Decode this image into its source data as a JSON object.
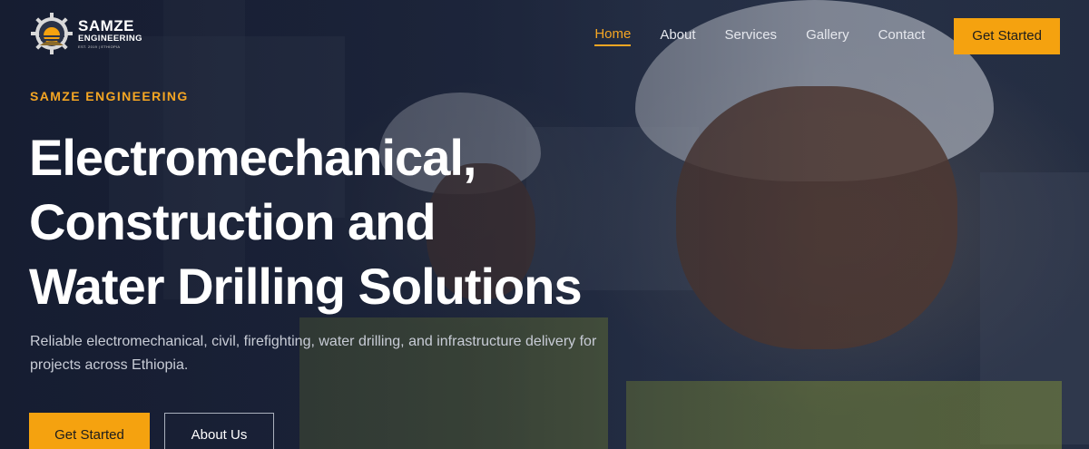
{
  "brand": {
    "name": "SAMZE",
    "sub": "ENGINEERING",
    "tagline": "EST. 2019 | ETHIOPIA"
  },
  "nav": {
    "items": [
      {
        "label": "Home",
        "active": true
      },
      {
        "label": "About",
        "active": false
      },
      {
        "label": "Services",
        "active": false
      },
      {
        "label": "Gallery",
        "active": false
      },
      {
        "label": "Contact",
        "active": false
      }
    ],
    "cta_label": "Get Started"
  },
  "hero": {
    "eyebrow": "SAMZE ENGINEERING",
    "headline_lines": [
      "Electromechanical,",
      "Construction and",
      "Water Drilling Solutions"
    ],
    "subtext": "Reliable electromechanical, civil, firefighting, water drilling, and infrastructure delivery for projects across Ethiopia.",
    "primary_button": "Get Started",
    "secondary_button": "About Us"
  },
  "colors": {
    "accent": "#f5a20f",
    "background": "#1d2740",
    "text": "#ffffff"
  }
}
